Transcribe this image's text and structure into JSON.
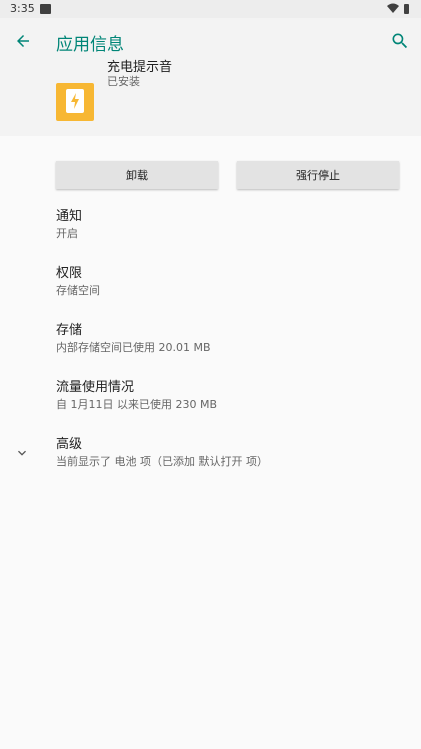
{
  "status_bar": {
    "time": "3:35"
  },
  "toolbar": {
    "title": "应用信息"
  },
  "app": {
    "name": "充电提示音",
    "status": "已安装"
  },
  "buttons": {
    "uninstall": "卸载",
    "force_stop": "强行停止"
  },
  "settings": [
    {
      "label": "通知",
      "summary": "开启"
    },
    {
      "label": "权限",
      "summary": "存储空间"
    },
    {
      "label": "存储",
      "summary": "内部存储空间已使用 20.01 MB"
    },
    {
      "label": "流量使用情况",
      "summary": "自 1月11日 以来已使用 230 MB"
    },
    {
      "label": "高级",
      "summary": "当前显示了 电池 项（已添加 默认打开 项）"
    }
  ],
  "colors": {
    "accent": "#008577",
    "app_icon": "#f7b733",
    "header_bg": "#f3f3f3"
  },
  "icons": [
    "back-arrow-icon",
    "search-icon",
    "wifi-icon",
    "battery-icon",
    "chevron-down-icon",
    "lightning-icon"
  ]
}
